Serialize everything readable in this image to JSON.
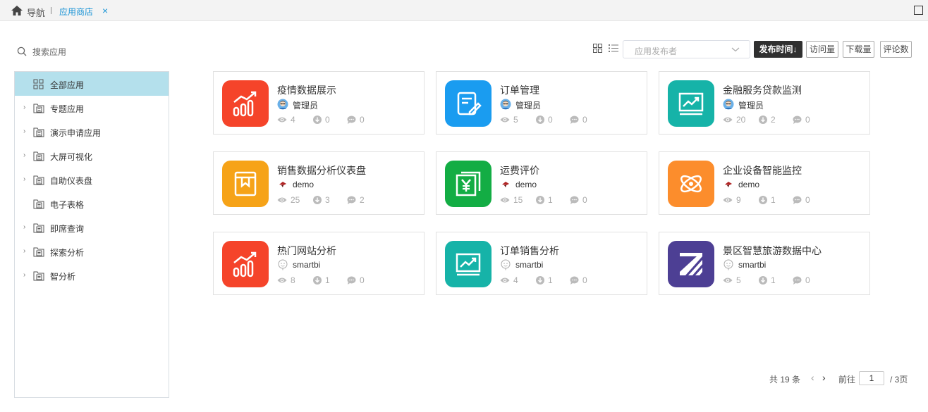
{
  "tabs": {
    "nav_label": "导航",
    "active_tab": "应用商店",
    "close_glyph": "×"
  },
  "sidebar": {
    "search_placeholder": "搜索应用",
    "items": [
      {
        "label": "全部应用",
        "icon": "grid-icon",
        "active": true,
        "expandable": false
      },
      {
        "label": "专题应用",
        "icon": "folder-doc-icon",
        "expandable": true
      },
      {
        "label": "演示申请应用",
        "icon": "folder-doc-icon",
        "expandable": true
      },
      {
        "label": "大屏可视化",
        "icon": "folder-doc-icon",
        "expandable": true
      },
      {
        "label": "自助仪表盘",
        "icon": "folder-doc-icon",
        "expandable": true
      },
      {
        "label": "电子表格",
        "icon": "folder-doc-icon",
        "expandable": false
      },
      {
        "label": "即席查询",
        "icon": "folder-doc-icon",
        "expandable": true
      },
      {
        "label": "探索分析",
        "icon": "folder-doc-icon",
        "expandable": true
      },
      {
        "label": "智分析",
        "icon": "folder-doc-icon",
        "expandable": true
      }
    ]
  },
  "toolbar": {
    "publisher_placeholder": "应用发布者",
    "sort_publish_time": "发布时间↓",
    "sort_visits": "访问量",
    "sort_downloads": "下载量",
    "sort_comments": "评论数"
  },
  "apps": [
    {
      "title": "疫情数据展示",
      "owner": "管理员",
      "owner_avatar": "admin-avatar",
      "views": "4",
      "downloads": "0",
      "comments": "0",
      "icon": "chart-up-icon",
      "color": "#f5442a"
    },
    {
      "title": "订单管理",
      "owner": "管理员",
      "owner_avatar": "admin-avatar",
      "views": "5",
      "downloads": "0",
      "comments": "0",
      "icon": "edit-doc-icon",
      "color": "#1a9cf0"
    },
    {
      "title": "金融服务贷款监测",
      "owner": "管理员",
      "owner_avatar": "admin-avatar",
      "views": "20",
      "downloads": "2",
      "comments": "0",
      "icon": "monitor-trend-icon",
      "color": "#16b3a8"
    },
    {
      "title": "销售数据分析仪表盘",
      "owner": "demo",
      "owner_avatar": "demo-avatar",
      "views": "25",
      "downloads": "3",
      "comments": "2",
      "icon": "book-icon",
      "color": "#f6a318"
    },
    {
      "title": "运费评价",
      "owner": "demo",
      "owner_avatar": "demo-avatar",
      "views": "15",
      "downloads": "1",
      "comments": "0",
      "icon": "yuan-doc-icon",
      "color": "#13ad44"
    },
    {
      "title": "企业设备智能监控",
      "owner": "demo",
      "owner_avatar": "demo-avatar",
      "views": "9",
      "downloads": "1",
      "comments": "0",
      "icon": "atom-icon",
      "color": "#fc8d2c"
    },
    {
      "title": "热门网站分析",
      "owner": "smartbi",
      "owner_avatar": "smartbi-avatar",
      "views": "8",
      "downloads": "1",
      "comments": "0",
      "icon": "chart-up-icon",
      "color": "#f5442a"
    },
    {
      "title": "订单销售分析",
      "owner": "smartbi",
      "owner_avatar": "smartbi-avatar",
      "views": "4",
      "downloads": "1",
      "comments": "0",
      "icon": "monitor-trend-icon",
      "color": "#16b3a8"
    },
    {
      "title": "景区智慧旅游数据中心",
      "owner": "smartbi",
      "owner_avatar": "smartbi-avatar",
      "views": "5",
      "downloads": "1",
      "comments": "0",
      "icon": "z-logo-icon",
      "color": "#4d3f94"
    }
  ],
  "pager": {
    "total": "共 19 条",
    "goto_label": "前往",
    "current_page": "1",
    "pages_label": "/ 3页"
  }
}
